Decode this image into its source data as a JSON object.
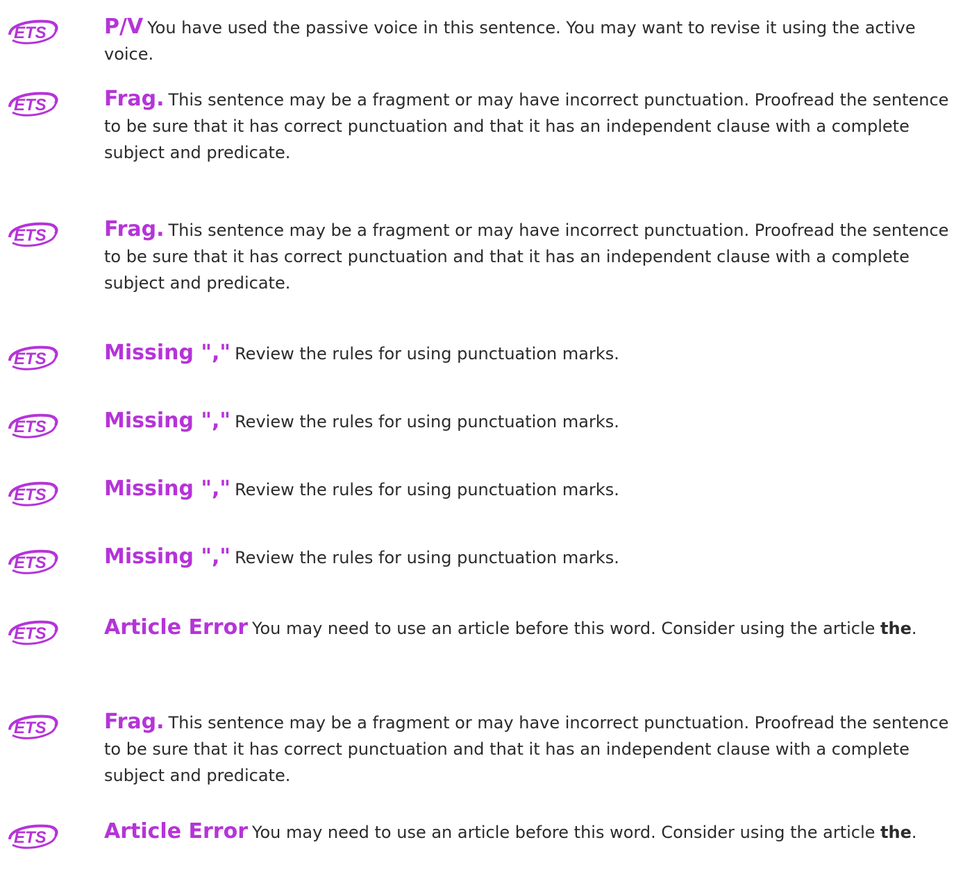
{
  "accent_color": "#b534d8",
  "logo_text": "ETS",
  "items": [
    {
      "tag": "P/V",
      "message": "You have used the passive voice in this sentence. You may want to revise it using the active voice.",
      "bold_word": "",
      "end": ""
    },
    {
      "tag": "Frag.",
      "message": "This sentence may be a fragment or may have incorrect punctuation. Proofread the sentence to be sure that it has correct punctuation and that it has an independent clause with a complete subject and predicate.",
      "bold_word": "",
      "end": ""
    },
    {
      "tag": "Frag.",
      "message": "This sentence may be a fragment or may have incorrect punctuation. Proofread the sentence to be sure that it has correct punctuation and that it has an independent clause with a complete subject and predicate.",
      "bold_word": "",
      "end": ""
    },
    {
      "tag": "Missing \",\"",
      "message": "Review the rules for using punctuation marks.",
      "bold_word": "",
      "end": ""
    },
    {
      "tag": "Missing \",\"",
      "message": "Review the rules for using punctuation marks.",
      "bold_word": "",
      "end": ""
    },
    {
      "tag": "Missing \",\"",
      "message": "Review the rules for using punctuation marks.",
      "bold_word": "",
      "end": ""
    },
    {
      "tag": "Missing \",\"",
      "message": "Review the rules for using punctuation marks.",
      "bold_word": "",
      "end": ""
    },
    {
      "tag": "Article Error",
      "message": "You may need to use an article before this word. Consider using the article ",
      "bold_word": "the",
      "end": "."
    },
    {
      "tag": "Frag.",
      "message": "This sentence may be a fragment or may have incorrect punctuation. Proofread the sentence to be sure that it has correct punctuation and that it has an independent clause with a complete subject and predicate.",
      "bold_word": "",
      "end": ""
    },
    {
      "tag": "Article Error",
      "message": "You may need to use an article before this word. Consider using the article ",
      "bold_word": "the",
      "end": "."
    }
  ]
}
